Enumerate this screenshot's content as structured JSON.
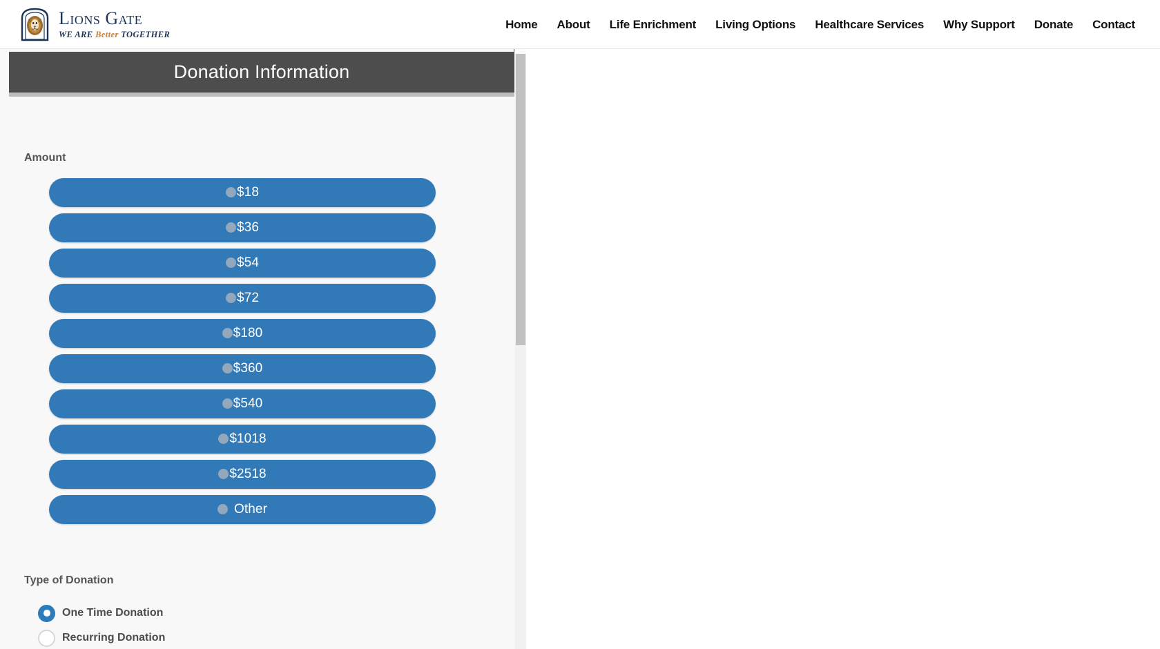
{
  "site": {
    "brand": {
      "name": "Lions Gate",
      "tagline_pre": "WE ARE ",
      "tagline_accent": "Better ",
      "tagline_post": "TOGETHER",
      "logo_icon": "lion-head-icon"
    },
    "nav": [
      {
        "label": "Home"
      },
      {
        "label": "About"
      },
      {
        "label": "Life Enrichment"
      },
      {
        "label": "Living Options"
      },
      {
        "label": "Healthcare Services"
      },
      {
        "label": "Why Support"
      },
      {
        "label": "Donate"
      },
      {
        "label": "Contact"
      }
    ]
  },
  "donation_panel": {
    "title": "Donation Information",
    "amount_section_label": "Amount",
    "amounts": [
      {
        "label": "$18",
        "value": "18",
        "selected": false
      },
      {
        "label": "$36",
        "value": "36",
        "selected": false
      },
      {
        "label": "$54",
        "value": "54",
        "selected": false
      },
      {
        "label": "$72",
        "value": "72",
        "selected": false
      },
      {
        "label": "$180",
        "value": "180",
        "selected": false
      },
      {
        "label": "$360",
        "value": "360",
        "selected": false
      },
      {
        "label": "$540",
        "value": "540",
        "selected": false
      },
      {
        "label": "$1018",
        "value": "1018",
        "selected": false
      },
      {
        "label": "$2518",
        "value": "2518",
        "selected": false
      },
      {
        "label": "Other",
        "value": "other",
        "selected": false
      }
    ],
    "type_section_label": "Type of Donation",
    "donation_types": [
      {
        "label": "One Time Donation",
        "selected": true
      },
      {
        "label": "Recurring Donation",
        "selected": false
      }
    ]
  },
  "colors": {
    "amount_button_blue": "#3279b7",
    "header_gray": "#4d4d4d",
    "radio_selected_blue": "#2b7cb9",
    "brand_navy": "#1d3557",
    "brand_accent_orange": "#c8803a",
    "panel_background": "#f8f8f8",
    "scrollbar_thumb": "#c1c1c1"
  }
}
